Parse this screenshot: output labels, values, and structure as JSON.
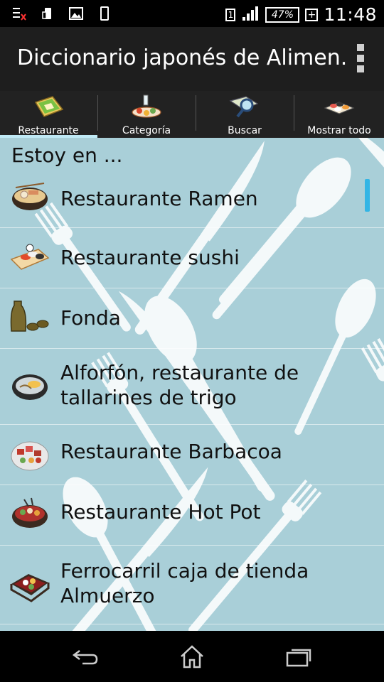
{
  "status_bar": {
    "sim_label": "1",
    "battery": "47%",
    "time": "11:48",
    "icons": [
      "notification-list-icon",
      "phone-icon",
      "image-icon",
      "device-icon",
      "signal-icon",
      "battery-icon"
    ]
  },
  "app_bar": {
    "title": "Diccionario japonés de Alimen.",
    "menu_icon": "overflow-menu-icon"
  },
  "tabs": [
    {
      "label": "Restaurante",
      "icon": "restaurant-tab-icon",
      "selected": true
    },
    {
      "label": "Categoría",
      "icon": "category-tab-icon",
      "selected": false
    },
    {
      "label": "Buscar",
      "icon": "search-tab-icon",
      "selected": false
    },
    {
      "label": "Mostrar todo",
      "icon": "show-all-tab-icon",
      "selected": false
    }
  ],
  "list": {
    "header": "Estoy en ...",
    "items": [
      {
        "label": "Restaurante Ramen",
        "icon": "ramen-bowl-icon"
      },
      {
        "label": "Restaurante sushi",
        "icon": "sushi-plate-icon"
      },
      {
        "label": "Fonda",
        "icon": "sake-bottle-icon"
      },
      {
        "label": "Alforfón, restaurante de tallarines de trigo",
        "icon": "soba-bowl-icon"
      },
      {
        "label": "Restaurante Barbacoa",
        "icon": "barbecue-plate-icon"
      },
      {
        "label": "Restaurante Hot Pot",
        "icon": "hot-pot-icon"
      },
      {
        "label": "Ferrocarril caja de tienda Almuerzo",
        "icon": "bento-box-icon"
      }
    ]
  },
  "nav_bar": {
    "back": "back-icon",
    "home": "home-icon",
    "recents": "recent-apps-icon"
  },
  "colors": {
    "list_background": "#a9cfd8",
    "tab_indicator": "#bfe9f5",
    "scrollbar": "#33b5e5",
    "app_bar": "#1e1e1e",
    "tab_bar": "#222222"
  }
}
